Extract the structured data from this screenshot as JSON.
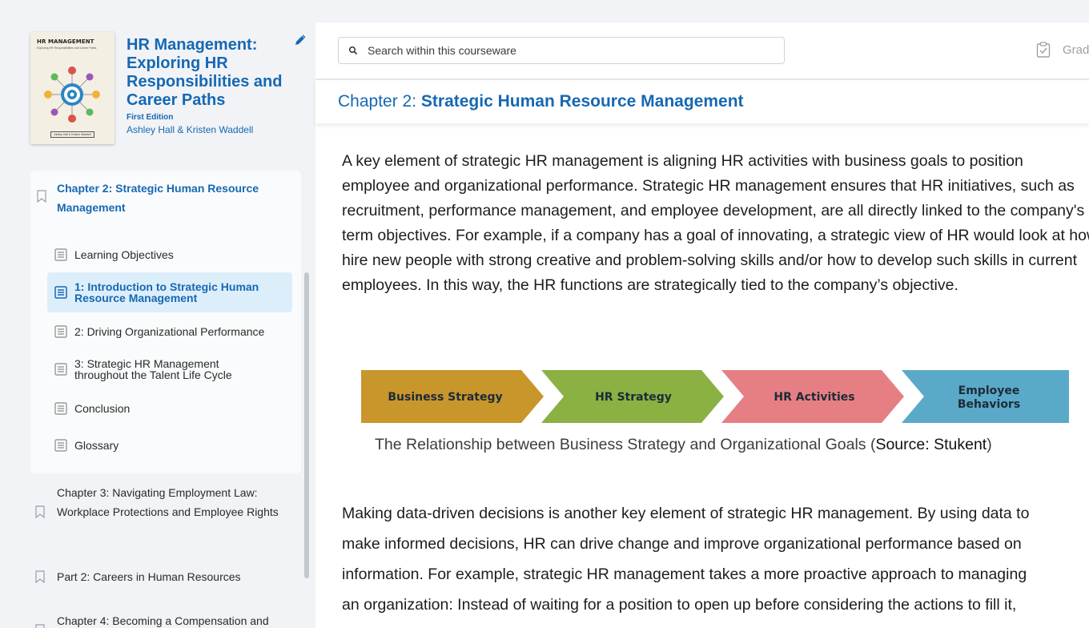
{
  "book": {
    "cover_title": "HR MANAGEMENT",
    "cover_subtitle": "Exploring HR Responsibilities and Career Paths",
    "cover_author": "Ashley Hall & Kristen Waddell",
    "title": "HR Management: Exploring HR Responsibilities and Career Paths",
    "edition": "First Edition",
    "authors": "Ashley Hall & Kristen Waddell"
  },
  "sidebar": {
    "current_chapter": "Chapter 2: Strategic Human Resource Management",
    "sections": [
      {
        "label": "Learning Objectives",
        "active": false
      },
      {
        "label": "1: Introduction to Strategic Human Resource Management",
        "active": true
      },
      {
        "label": "2: Driving Organizational Performance",
        "active": false
      },
      {
        "label": "3: Strategic HR Management throughout the Talent Life Cycle",
        "active": false
      },
      {
        "label": "Conclusion",
        "active": false
      },
      {
        "label": "Glossary",
        "active": false
      }
    ],
    "other_items": [
      {
        "label": "Chapter 3: Navigating Employment Law: Workplace Protections and Employee Rights"
      },
      {
        "label": "Part 2: Careers in Human Resources"
      },
      {
        "label": "Chapter 4: Becoming a Compensation and"
      }
    ]
  },
  "topbar": {
    "search_placeholder": "Search within this courseware",
    "grades_label": "Grades"
  },
  "chapter_header": {
    "prefix": "Chapter 2: ",
    "title": "Strategic Human Resource Management"
  },
  "content": {
    "paragraph1_lines": [
      "A key element of strategic HR management is aligning HR activities with business goals to position",
      "employee and organizational performance. Strategic HR management ensures that HR initiatives, such as",
      "recruitment, performance management, and employee development, are all directly linked to the company's long-",
      "term objectives. For example, if a company has a goal of innovating, a strategic view of HR would look at how to",
      "hire new people with strong creative and problem-solving skills and/or how to develop such skills in current",
      "employees. In this way, the HR functions are strategically tied to the company’s objective."
    ],
    "diagram_steps": [
      {
        "label": "Business Strategy",
        "color": "#c9962c"
      },
      {
        "label": "HR Strategy",
        "color": "#8bb143"
      },
      {
        "label": "HR Activities",
        "color": "#e67f84"
      },
      {
        "label": "Employee Behaviors",
        "color": "#5ba9c9"
      }
    ],
    "caption_main": "The Relationship between Business Strategy and Organizational Goals (",
    "caption_source": "Source: Stukent",
    "caption_end": ")",
    "paragraph2_lines": [
      "Making data-driven decisions is another key element of strategic HR management. By using data to",
      "make informed decisions, HR can drive change and improve organizational performance based on",
      "information. For example, strategic HR management takes a more proactive approach to managing",
      "an organization: Instead of waiting for a position to open up before considering the actions to fill it,"
    ]
  }
}
